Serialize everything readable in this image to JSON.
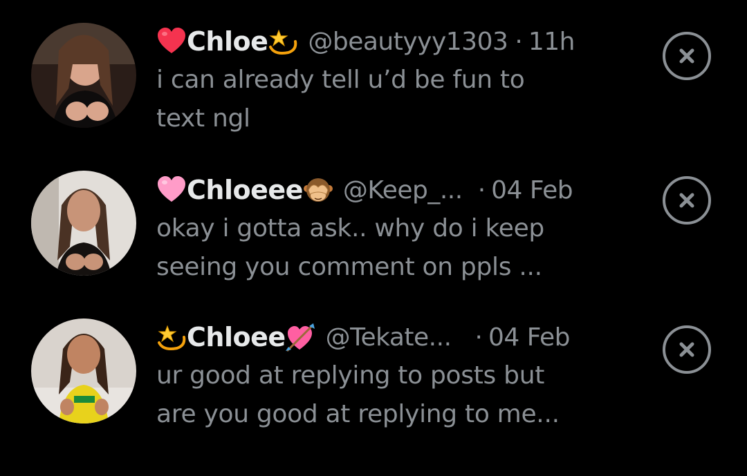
{
  "requests": [
    {
      "name": "Chloe",
      "emoji_before": "red-heart",
      "emoji_after": "dizzy-star",
      "handle": "@beautyyy1303",
      "separator": "·",
      "time": "11h",
      "message_line1": "i can already tell u’d be fun to",
      "message_line2": "text ngl",
      "avatar_tone": "#3a2a24"
    },
    {
      "name": "Chloeee",
      "emoji_before": "pink-heart",
      "emoji_after": "see-no-evil-monkey",
      "handle": "@Keep_...",
      "separator": "·",
      "time": "04 Feb",
      "message_line1": "okay i gotta ask.. why do i keep",
      "message_line2": "seeing you comment on ppls ...",
      "avatar_tone": "#d8d4cf"
    },
    {
      "name": "Chloee",
      "emoji_before": "dizzy-star",
      "emoji_after": "heart-with-arrow",
      "handle": "@Tekate...",
      "separator": "·",
      "time": "04 Feb",
      "message_line1": "ur good at replying to posts but",
      "message_line2": "are you good at replying to me...",
      "avatar_tone": "#cfc8c2"
    }
  ],
  "colors": {
    "background": "#000000",
    "name": "#e7e9ea",
    "secondary": "#8b9095"
  }
}
